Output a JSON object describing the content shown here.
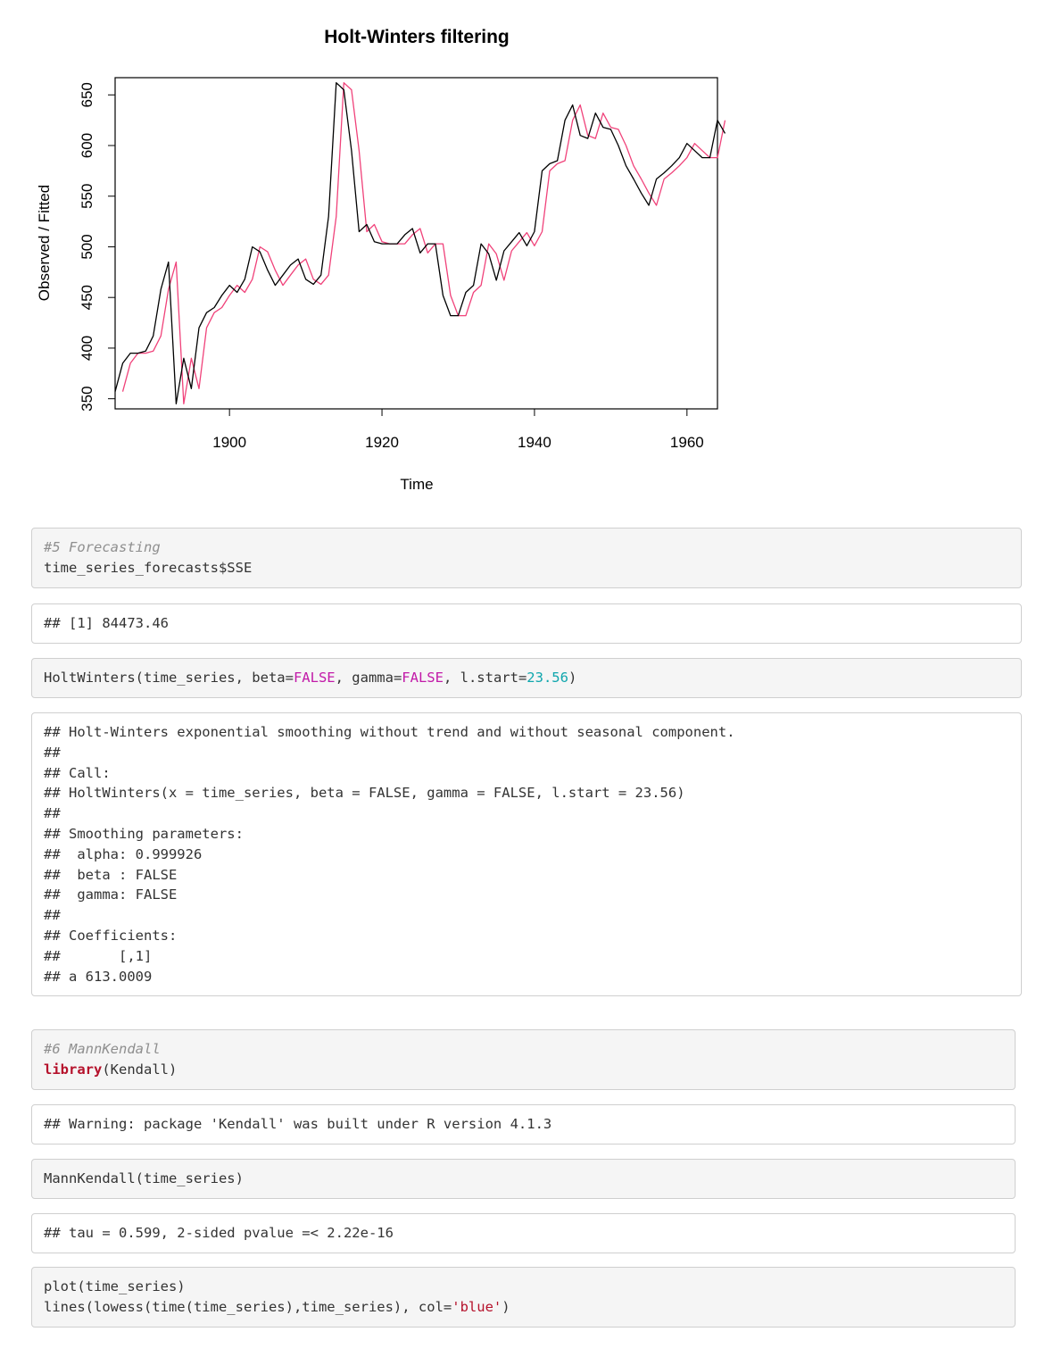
{
  "chart_data": {
    "type": "line",
    "title": "Holt-Winters filtering",
    "xlabel": "Time",
    "ylabel": "Observed / Fitted",
    "xlim": [
      1885,
      1964
    ],
    "ylim": [
      340,
      667
    ],
    "xticks": [
      1900,
      1920,
      1940,
      1960
    ],
    "yticks": [
      350,
      400,
      450,
      500,
      550,
      600,
      650
    ],
    "grid": false,
    "legend": "none",
    "x_start": 1885,
    "series": [
      {
        "color": "#000000",
        "values": [
          357,
          385,
          395,
          395,
          397,
          412,
          458,
          485,
          345,
          390,
          360,
          420,
          435,
          440,
          452,
          462,
          455,
          468,
          500,
          495,
          477,
          462,
          472,
          482,
          488,
          468,
          463,
          472,
          530,
          662,
          655,
          595,
          515,
          522,
          505,
          503,
          503,
          503,
          512,
          518,
          494,
          503,
          503,
          452,
          432,
          432,
          455,
          462,
          503,
          493,
          467,
          496,
          505,
          514,
          501,
          515,
          575,
          582,
          585,
          625,
          640,
          610,
          607,
          632,
          618,
          616,
          600,
          580,
          567,
          553,
          541,
          567,
          573,
          580,
          588,
          602,
          595,
          588,
          588,
          625,
          612
        ]
      },
      {
        "color": "#f0427a",
        "values": [
          null,
          357,
          385,
          395,
          395,
          397,
          412,
          458,
          485,
          345,
          390,
          360,
          420,
          435,
          440,
          452,
          462,
          455,
          468,
          500,
          495,
          477,
          462,
          472,
          482,
          488,
          468,
          463,
          472,
          530,
          662,
          655,
          595,
          515,
          522,
          505,
          503,
          503,
          503,
          512,
          518,
          494,
          503,
          503,
          452,
          432,
          432,
          455,
          462,
          503,
          493,
          467,
          496,
          505,
          514,
          501,
          515,
          575,
          582,
          585,
          625,
          640,
          610,
          607,
          632,
          618,
          616,
          600,
          580,
          567,
          553,
          541,
          567,
          573,
          580,
          588,
          602,
          595,
          588,
          588,
          625
        ]
      }
    ]
  },
  "blocks": [
    {
      "kind": "code",
      "lines": [
        [
          {
            "t": "#5 Forecasting",
            "c": "cmt"
          }
        ],
        [
          {
            "t": "time_series_forecasts$SSE"
          }
        ]
      ]
    },
    {
      "kind": "out",
      "lines": [
        [
          {
            "t": "## [1] 84473.46"
          }
        ]
      ]
    },
    {
      "kind": "code",
      "lines": [
        [
          {
            "t": "HoltWinters(time_series, beta="
          },
          {
            "t": "FALSE",
            "c": "const"
          },
          {
            "t": ", gamma="
          },
          {
            "t": "FALSE",
            "c": "const"
          },
          {
            "t": ", l.start="
          },
          {
            "t": "23.56",
            "c": "num"
          },
          {
            "t": ")"
          }
        ]
      ]
    },
    {
      "kind": "out",
      "lines": [
        [
          {
            "t": "## Holt-Winters exponential smoothing without trend and without seasonal component."
          }
        ],
        [
          {
            "t": "##"
          }
        ],
        [
          {
            "t": "## Call:"
          }
        ],
        [
          {
            "t": "## HoltWinters(x = time_series, beta = FALSE, gamma = FALSE, l.start = 23.56)"
          }
        ],
        [
          {
            "t": "##"
          }
        ],
        [
          {
            "t": "## Smoothing parameters:"
          }
        ],
        [
          {
            "t": "##  alpha: 0.999926"
          }
        ],
        [
          {
            "t": "##  beta : FALSE"
          }
        ],
        [
          {
            "t": "##  gamma: FALSE"
          }
        ],
        [
          {
            "t": "##"
          }
        ],
        [
          {
            "t": "## Coefficients:"
          }
        ],
        [
          {
            "t": "##       [,1]"
          }
        ],
        [
          {
            "t": "## a 613.0009"
          }
        ]
      ]
    },
    {
      "kind": "code",
      "lines": [
        [
          {
            "t": "#6 MannKendall",
            "c": "cmt"
          }
        ],
        [
          {
            "t": "library",
            "c": "kw"
          },
          {
            "t": "(Kendall)"
          }
        ]
      ]
    },
    {
      "kind": "out",
      "lines": [
        [
          {
            "t": "## Warning: package 'Kendall' was built under R version 4.1.3"
          }
        ]
      ]
    },
    {
      "kind": "code",
      "lines": [
        [
          {
            "t": "MannKendall(time_series)"
          }
        ]
      ]
    },
    {
      "kind": "out",
      "lines": [
        [
          {
            "t": "## tau = 0.599, 2-sided pvalue =< 2.22e-16"
          }
        ]
      ]
    },
    {
      "kind": "code",
      "lines": [
        [
          {
            "t": "plot(time_series)"
          }
        ],
        [
          {
            "t": "lines(lowess(time(time_series),time_series), col="
          },
          {
            "t": "'blue'",
            "c": "str"
          },
          {
            "t": ")"
          }
        ]
      ]
    }
  ]
}
